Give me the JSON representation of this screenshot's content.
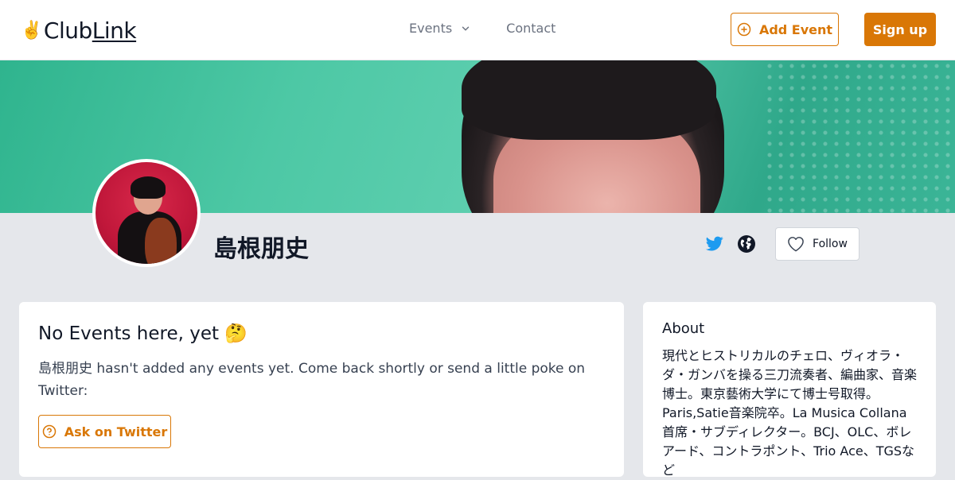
{
  "header": {
    "logo_emoji": "✌️",
    "logo_text_a": "Club",
    "logo_text_b": "Link",
    "nav": [
      {
        "label": "Events"
      },
      {
        "label": "Contact"
      }
    ],
    "add_event_label": "Add Event",
    "sign_up_label": "Sign up",
    "accent_color": "#d97706"
  },
  "profile": {
    "name": "島根朋史",
    "follow_label": "Follow"
  },
  "events_card": {
    "title": "No Events here, yet 🤔",
    "text": "島根朋史 hasn't added any events yet. Come back shortly or send a little poke on Twitter:",
    "ask_label": "Ask on Twitter"
  },
  "about_card": {
    "title": "About",
    "text": "現代とヒストリカルのチェロ、ヴィオラ・ダ・ガンバを操る三刀流奏者、編曲家、音楽博士。東京藝術大学にて博士号取得。Paris,Satie音楽院卒。La Musica Collana首席・サブディレクター。BCJ、OLC、ボレアード、コントラポント、Trio Ace、TGSなど"
  },
  "icons": [
    "chevron-down-icon",
    "plus-circle-icon",
    "twitter-icon",
    "globe-icon",
    "heart-icon",
    "help-circle-icon"
  ]
}
